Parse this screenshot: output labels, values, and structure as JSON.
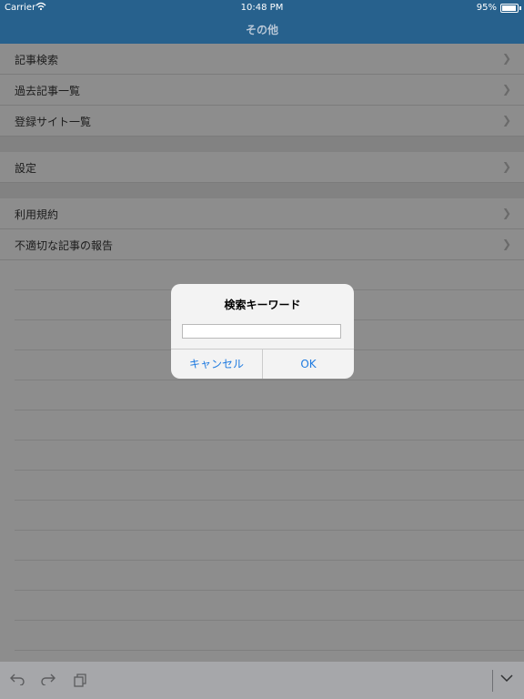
{
  "status_bar": {
    "carrier": "Carrier",
    "time": "10:48 PM",
    "battery": "95%"
  },
  "nav": {
    "title": "その他"
  },
  "sections": [
    {
      "items": [
        {
          "label": "記事検索"
        },
        {
          "label": "過去記事一覧"
        },
        {
          "label": "登録サイト一覧"
        }
      ]
    },
    {
      "items": [
        {
          "label": "設定"
        }
      ]
    },
    {
      "items": [
        {
          "label": "利用規約"
        },
        {
          "label": "不適切な記事の報告"
        }
      ]
    }
  ],
  "dialog": {
    "title": "検索キーワード",
    "input_value": "",
    "cancel_label": "キャンセル",
    "ok_label": "OK"
  },
  "toolbar": {
    "icons": [
      "undo-icon",
      "redo-icon",
      "paste-icon",
      "hide-keyboard-icon"
    ]
  },
  "colors": {
    "nav_bar": "#27618d",
    "button_text": "#1f7be0"
  }
}
